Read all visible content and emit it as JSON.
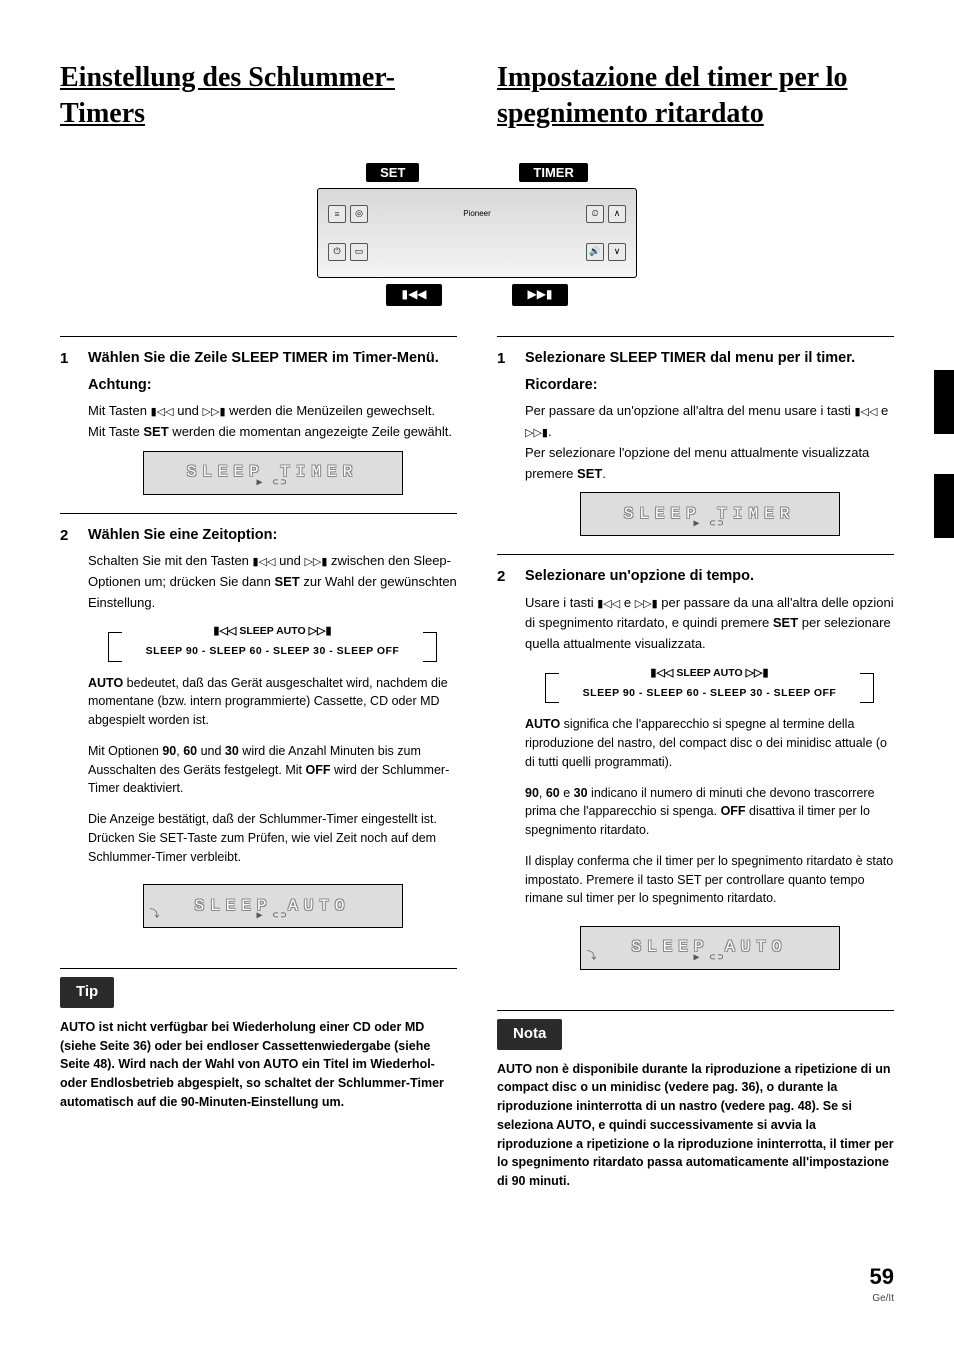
{
  "titles": {
    "left": "Einstellung des Schlummer-Timers",
    "right": "Impostazione del timer per lo spegnimento ritardato"
  },
  "device_labels": {
    "set": "SET",
    "timer": "TIMER"
  },
  "track_icons": {
    "prev": "▮◀◀",
    "next": "▶▶▮"
  },
  "display_text": {
    "sleep_timer": "SLEEP TIMER",
    "sleep_auto": "SLEEP  AUTO",
    "subicon": "▶ ⊂⊃"
  },
  "left": {
    "step1": {
      "num": "1",
      "title": "Wählen Sie die Zeile SLEEP TIMER im Timer-Menü.",
      "subtitle": "Achtung:",
      "line1_pre": "Mit Tasten ",
      "line1_mid": " und ",
      "line1_post": " werden die Menüzeilen gewechselt.",
      "line2_pre": "Mit Taste ",
      "line2_post": " werden die momentan angezeigte Zeile gewählt."
    },
    "step2": {
      "num": "2",
      "title": "Wählen Sie eine Zeitoption:",
      "cycle_pre": "Schalten Sie mit den Tasten ",
      "cycle_mid": " und ",
      "cycle_post": " zwischen den Sleep-Optionen um; drücken Sie dann ",
      "cycle_end": " zur Wahl der gewünschten Einstellung.",
      "sleep_auto_label": "SLEEP AUTO",
      "sleep_options": "SLEEP 90 - SLEEP 60 - SLEEP 30 - SLEEP OFF",
      "auto_label": "AUTO",
      "auto_text": " bedeutet, daß das Gerät ausgeschaltet wird, nachdem die momentane (bzw. intern programmierte) Cassette, CD oder MD abgespielt worden ist.",
      "numbers_line_pre": "Mit Optionen ",
      "numbers_line_mid1": ", ",
      "numbers_line_mid2": " und ",
      "numbers_line_post": " wird die Anzahl Minuten bis zum Ausschalten des Geräts festgelegt. Mit ",
      "numbers_line_end": " wird der Schlummer-Timer deaktiviert.",
      "n90": "90",
      "n60": "60",
      "n30": "30",
      "off": "OFF",
      "tail": "Die Anzeige bestätigt, daß der Schlummer-Timer eingestellt ist. Drücken Sie SET-Taste zum Prüfen, wie viel Zeit noch auf dem Schlummer-Timer verbleibt."
    },
    "tip": {
      "label": "Tip",
      "text": "AUTO ist nicht verfügbar bei Wiederholung einer CD oder MD (siehe Seite 36) oder bei endloser Cassettenwiedergabe (siehe Seite 48). Wird nach der Wahl von AUTO ein Titel im Wiederhol- oder Endlosbetrieb abgespielt, so schaltet der Schlummer-Timer automatisch auf die 90-Minuten-Einstellung um."
    }
  },
  "right": {
    "step1": {
      "num": "1",
      "title": "Selezionare SLEEP TIMER dal menu per il timer.",
      "subtitle": "Ricordare:",
      "line1_pre": "Per passare da un'opzione all'altra del menu usare i tasti ",
      "line1_mid": " e ",
      "line1_post": ".",
      "line2_pre": "Per selezionare l'opzione del menu attualmente visualizzata premere ",
      "line2_post": "."
    },
    "step2": {
      "num": "2",
      "title": "Selezionare un'opzione di tempo.",
      "cycle_pre": "Usare i tasti ",
      "cycle_mid": " e ",
      "cycle_post": " per passare da una all'altra delle opzioni di spegnimento ritardato, e quindi premere ",
      "cycle_end": " per selezionare quella attualmente visualizzata.",
      "sleep_auto_label": "SLEEP AUTO",
      "sleep_options": "SLEEP 90 - SLEEP 60 - SLEEP 30 - SLEEP OFF",
      "auto_label": "AUTO",
      "auto_text": " significa che l'apparecchio si spegne al termine della riproduzione del nastro, del compact disc o dei minidisc attuale (o di tutti quelli programmati).",
      "numbers_line_pre": "",
      "numbers_line_mid1": ", ",
      "numbers_line_mid2": " e ",
      "numbers_line_post": " indicano il numero di minuti che devono trascorrere prima che l'apparecchio si spenga. ",
      "numbers_line_end": " disattiva il timer per lo spegnimento ritardato.",
      "n90": "90",
      "n60": "60",
      "n30": "30",
      "off": "OFF",
      "tail": "Il display conferma che il timer per lo spegnimento ritardato è stato impostato. Premere il tasto SET per controllare quanto tempo rimane sul timer per lo spegnimento ritardato."
    },
    "tip": {
      "label": "Nota",
      "text": "AUTO non è disponibile durante la riproduzione a ripetizione di un compact disc o un minidisc (vedere pag. 36), o durante la riproduzione ininterrotta di un nastro (vedere pag. 48). Se si seleziona AUTO, e quindi successivamente si avvia la riproduzione a ripetizione o la riproduzione ininterrotta, il timer per lo spegnimento ritardato passa automaticamente all'impostazione di 90 minuti."
    }
  },
  "set_word": "SET",
  "icons": {
    "prev": "▮◁◁",
    "next": "▷▷▮",
    "prev_small": "◁◁",
    "next_small": "▷▷"
  },
  "page_number": "59",
  "lang": "Ge/It"
}
